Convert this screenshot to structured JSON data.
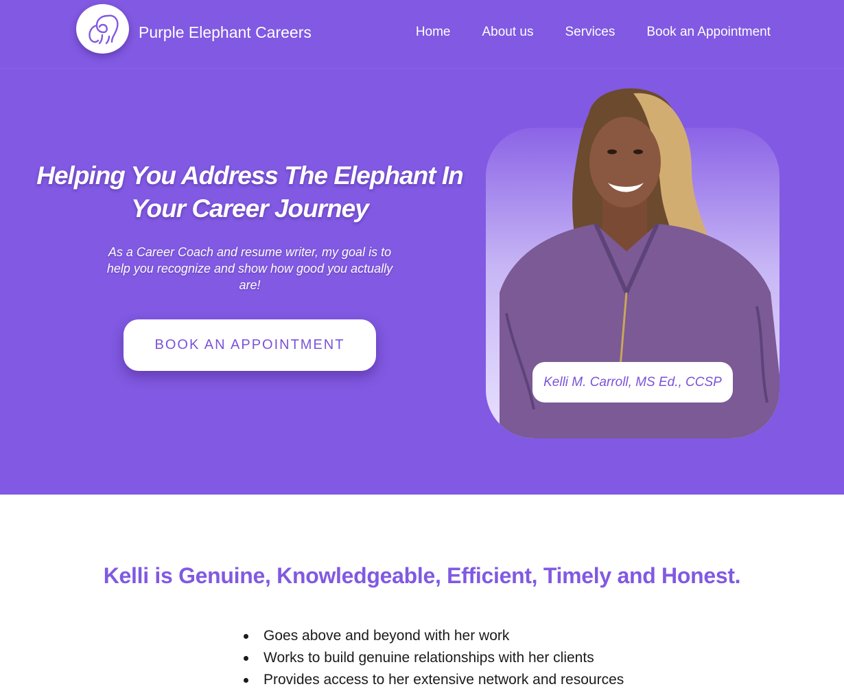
{
  "header": {
    "brand": "Purple Elephant Careers",
    "logo_icon": "elephant-logo-icon",
    "nav": [
      "Home",
      "About us",
      "Services",
      "Book an Appointment"
    ]
  },
  "hero": {
    "title": "Helping You Address The Elephant In Your Career Journey",
    "subtitle": "As a Career Coach and resume writer, my goal is to help you recognize and show how good you actually are!",
    "cta_label": "BOOK AN APPOINTMENT",
    "portrait_name": "Kelli M. Carroll, MS Ed., CCSP"
  },
  "about": {
    "heading": "Kelli is Genuine, Knowledgeable, Efficient, Timely and Honest.",
    "traits": [
      "Goes above and beyond with her work",
      "Works to build genuine relationships with her clients",
      "Provides access to her extensive network and resources"
    ]
  },
  "colors": {
    "brand_purple": "#8159e2",
    "accent_text": "#7b52d8",
    "white": "#ffffff"
  }
}
